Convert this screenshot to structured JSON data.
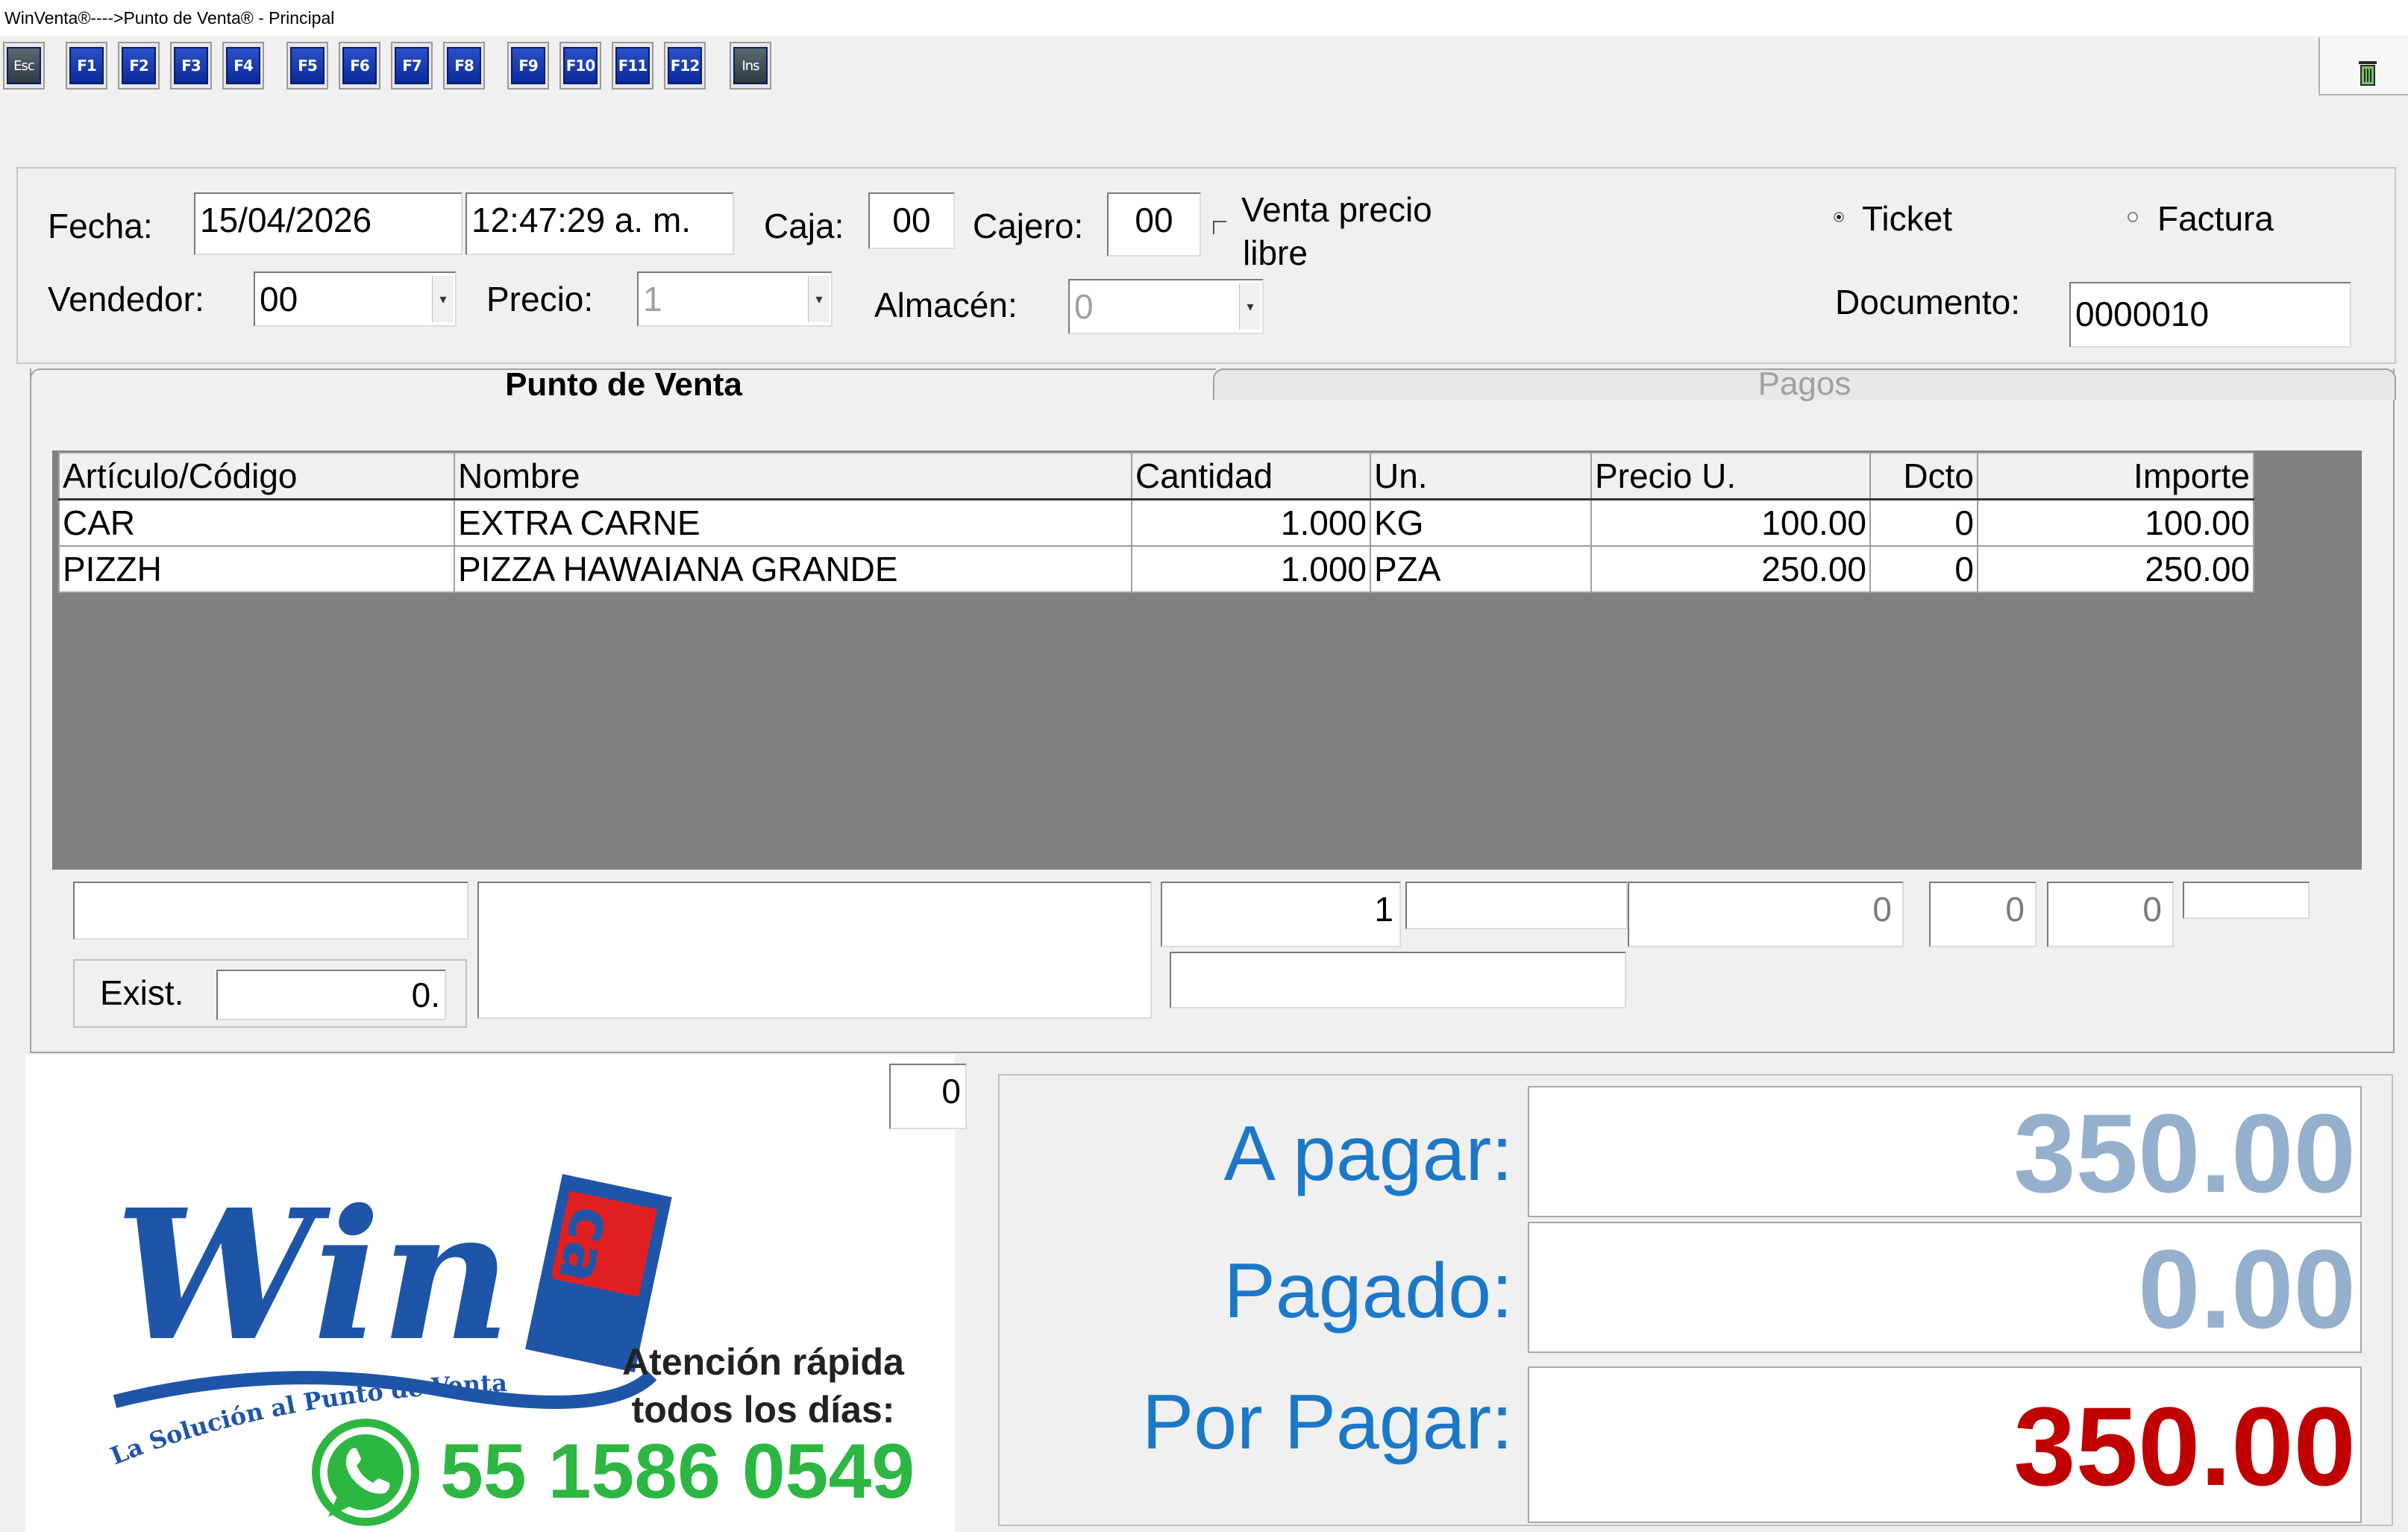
{
  "window": {
    "title": "WinVenta®---->Punto de Venta® - Principal"
  },
  "toolbar": {
    "keys": [
      "Esc",
      "F1",
      "F2",
      "F3",
      "F4",
      "F5",
      "F6",
      "F7",
      "F8",
      "F9",
      "F10",
      "F11",
      "F12",
      "Ins"
    ],
    "trash_icon": "trash-icon"
  },
  "header": {
    "fecha_label": "Fecha:",
    "fecha": "15/04/2026",
    "hora": "12:47:29 a. m.",
    "caja_label": "Caja:",
    "caja": "00",
    "cajero_label": "Cajero:",
    "cajero": "00",
    "venta_libre_label_1": "Venta  precio",
    "venta_libre_label_2": "libre",
    "ticket_label": "Ticket",
    "factura_label": "Factura",
    "vendedor_label": "Vendedor:",
    "vendedor": "00",
    "precio_label": "Precio:",
    "precio": "1",
    "almacen_label": "Almacén:",
    "almacen": "0",
    "documento_label": "Documento:",
    "documento": "0000010"
  },
  "tabs": {
    "punto_venta": "Punto de Venta",
    "pagos": "Pagos"
  },
  "grid": {
    "columns": [
      "Artículo/Código",
      "Nombre",
      "Cantidad",
      "Un.",
      "Precio U.",
      "Dcto",
      "Importe"
    ],
    "rows": [
      [
        "CAR",
        "EXTRA CARNE",
        "1.000",
        "KG",
        "100.00",
        "0",
        "100.00"
      ],
      [
        "PIZZH",
        "PIZZA HAWAIANA GRANDE",
        "1.000",
        "PZA",
        "250.00",
        "0",
        "250.00"
      ]
    ]
  },
  "entry": {
    "cantidad": "1",
    "precio": "0",
    "dcto": "0",
    "importe": "0",
    "exist_label": "Exist.",
    "exist": "0.",
    "counter": "0"
  },
  "promo": {
    "brand_word": "Win",
    "brand_tag": "caja",
    "tagline": "La Solución al Punto de Venta",
    "line1": "Atención rápida",
    "line2": "todos los días:",
    "phone": "55 1586 0549"
  },
  "totals": {
    "a_pagar_label": "A pagar:",
    "a_pagar": "350.00",
    "pagado_label": "Pagado:",
    "pagado": "0.00",
    "por_pagar_label": "Por Pagar:",
    "por_pagar": "350.00",
    "colors": {
      "label": "#1b78c8",
      "muted_value": "#94b0cc",
      "due_value": "#c00000"
    }
  }
}
